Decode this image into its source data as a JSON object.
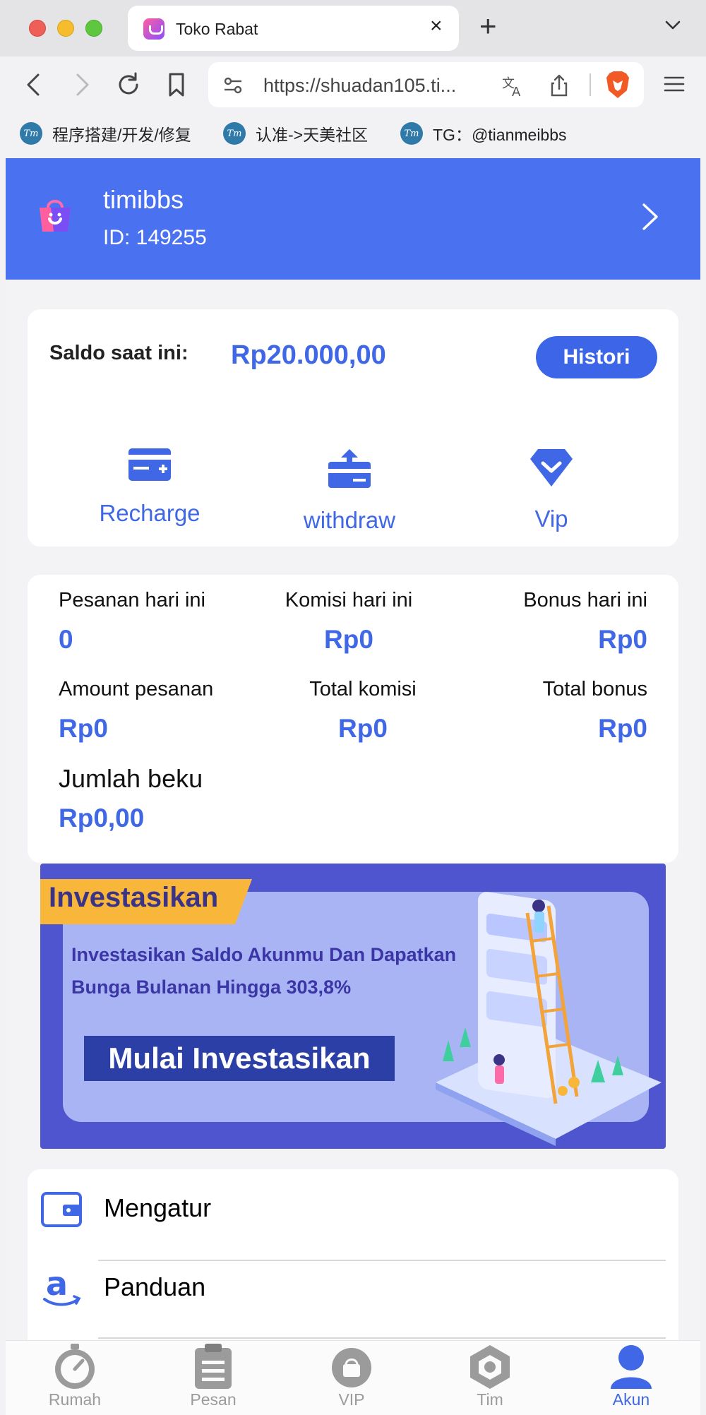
{
  "browser": {
    "tab_title": "Toko Rabat",
    "url": "https://shuadan105.ti...",
    "bookmarks": [
      {
        "icon_text": "Tm",
        "label": "程序搭建/开发/修复"
      },
      {
        "icon_text": "Tm",
        "label": "认准->天美社区"
      },
      {
        "icon_text": "Tm",
        "label": "TG：@tianmeibbs"
      }
    ]
  },
  "profile": {
    "name": "timibbs",
    "id_text": "ID: 149255"
  },
  "balance": {
    "label": "Saldo saat ini:",
    "value": "Rp20.000,00",
    "history_label": "Histori"
  },
  "actions": {
    "recharge": "Recharge",
    "withdraw": "withdraw",
    "vip": "Vip"
  },
  "stats": {
    "orders_today_label": "Pesanan hari ini",
    "orders_today_value": "0",
    "commission_today_label": "Komisi hari ini",
    "commission_today_value": "Rp0",
    "bonus_today_label": "Bonus hari ini",
    "bonus_today_value": "Rp0",
    "order_amount_label": "Amount pesanan",
    "order_amount_value": "Rp0",
    "total_commission_label": "Total komisi",
    "total_commission_value": "Rp0",
    "total_bonus_label": "Total bonus",
    "total_bonus_value": "Rp0",
    "frozen_label": "Jumlah beku",
    "frozen_value": "Rp0,00"
  },
  "banner": {
    "ribbon": "Investasikan",
    "line1": "Investasikan Saldo Akunmu Dan Dapatkan",
    "line2": "Bunga Bulanan Hingga 303,8%",
    "cta": "Mulai Investasikan"
  },
  "menu": {
    "settings": "Mengatur",
    "guide": "Panduan"
  },
  "bottom_nav": {
    "home": "Rumah",
    "orders": "Pesan",
    "vip": "VIP",
    "team": "Tim",
    "account": "Akun",
    "active": "account"
  },
  "colors": {
    "accent": "#3f67e6",
    "header_bg": "#4a71f0",
    "inactive": "#9b9b9b"
  }
}
